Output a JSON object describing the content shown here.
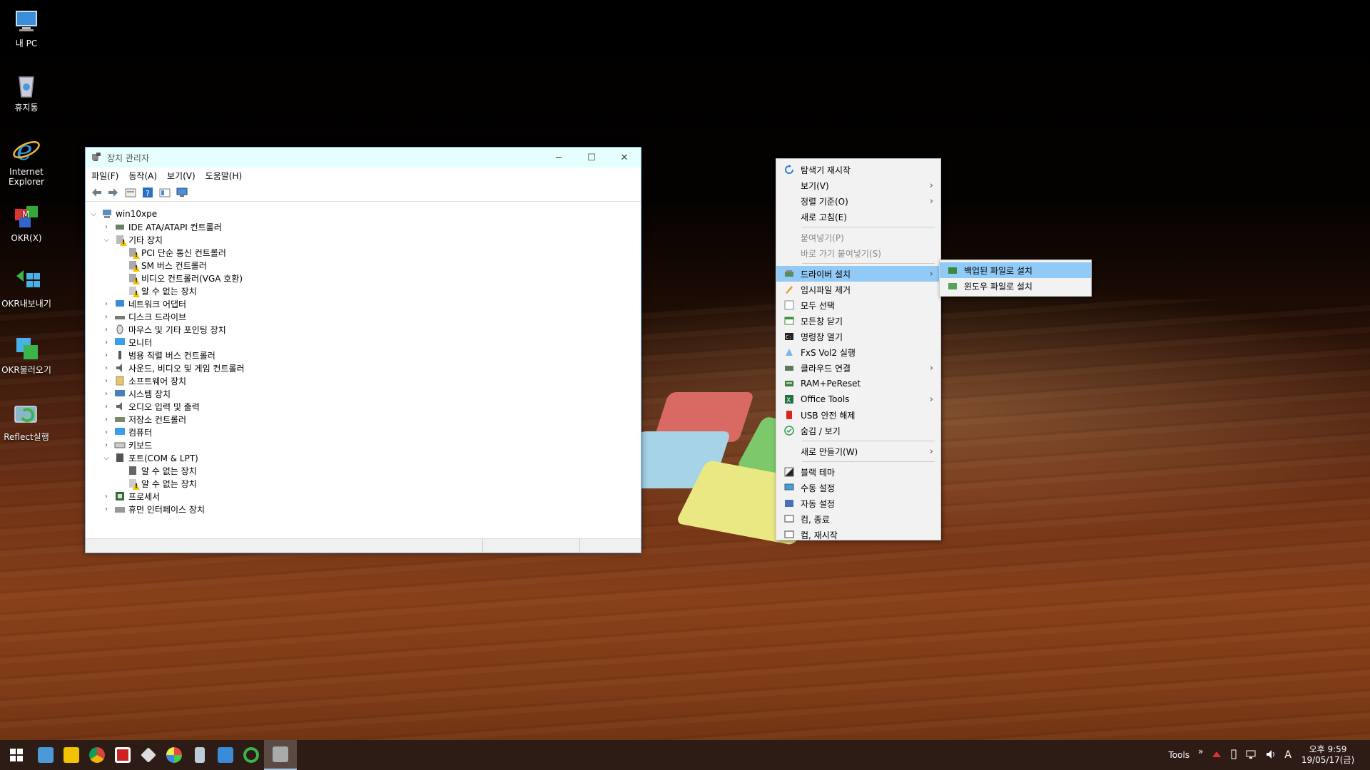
{
  "desktop": {
    "icons": [
      {
        "label": "내 PC"
      },
      {
        "label": "휴지통"
      },
      {
        "label": "Internet Explorer"
      },
      {
        "label": "OKR(X)"
      },
      {
        "label": "OKR내보내기"
      },
      {
        "label": "OKR불러오기"
      },
      {
        "label": "Reflect실행"
      }
    ]
  },
  "window": {
    "title": "장치 관리자",
    "controls": {
      "minimize": "─",
      "maximize": "☐",
      "close": "✕"
    },
    "menu": [
      "파일(F)",
      "동작(A)",
      "보기(V)",
      "도움말(H)"
    ],
    "tree": [
      {
        "label": "win10xpe",
        "expand": "open"
      },
      {
        "label": "IDE ATA/ATAPI 컨트롤러",
        "expand": "closed"
      },
      {
        "label": "기타 장치",
        "expand": "open"
      },
      {
        "label": "PCI 단순 통신 컨트롤러",
        "expand": "none"
      },
      {
        "label": "SM 버스 컨트롤러",
        "expand": "none"
      },
      {
        "label": "비디오 컨트롤러(VGA 호환)",
        "expand": "none"
      },
      {
        "label": "알 수 없는 장치",
        "expand": "none"
      },
      {
        "label": "네트워크 어댑터",
        "expand": "closed"
      },
      {
        "label": "디스크 드라이브",
        "expand": "closed"
      },
      {
        "label": "마우스 및 기타 포인팅 장치",
        "expand": "closed"
      },
      {
        "label": "모니터",
        "expand": "closed"
      },
      {
        "label": "범용 직렬 버스 컨트롤러",
        "expand": "closed"
      },
      {
        "label": "사운드, 비디오 및 게임 컨트롤러",
        "expand": "closed"
      },
      {
        "label": "소프트웨어 장치",
        "expand": "closed"
      },
      {
        "label": "시스템 장치",
        "expand": "closed"
      },
      {
        "label": "오디오 입력 및 출력",
        "expand": "closed"
      },
      {
        "label": "저장소 컨트롤러",
        "expand": "closed"
      },
      {
        "label": "컴퓨터",
        "expand": "closed"
      },
      {
        "label": "키보드",
        "expand": "closed"
      },
      {
        "label": "포트(COM & LPT)",
        "expand": "open"
      },
      {
        "label": "알 수 없는 장치",
        "expand": "none"
      },
      {
        "label": "알 수 없는 장치",
        "expand": "none"
      },
      {
        "label": "프로세서",
        "expand": "closed"
      },
      {
        "label": "휴먼 인터페이스 장치",
        "expand": "closed"
      }
    ]
  },
  "context_menu": {
    "items": [
      {
        "label": "탐색기 재시작",
        "icon": "refresh-icon",
        "arrow": false,
        "disabled": false
      },
      {
        "label": "보기(V)",
        "icon": "",
        "arrow": true,
        "disabled": false
      },
      {
        "label": "정렬 기준(O)",
        "icon": "",
        "arrow": true,
        "disabled": false
      },
      {
        "label": "새로 고침(E)",
        "icon": "",
        "arrow": false,
        "disabled": false
      },
      {
        "label": "붙여넣기(P)",
        "icon": "",
        "arrow": false,
        "disabled": true
      },
      {
        "label": "바로 가기 붙여넣기(S)",
        "icon": "",
        "arrow": false,
        "disabled": true
      },
      {
        "label": "드라이버 설치",
        "icon": "driver-icon",
        "arrow": true,
        "disabled": false,
        "highlighted": true
      },
      {
        "label": "임시파일 제거",
        "icon": "broom-icon",
        "arrow": false,
        "disabled": false
      },
      {
        "label": "모두     선택",
        "icon": "select-all-icon",
        "arrow": false,
        "disabled": false
      },
      {
        "label": "모든창   닫기",
        "icon": "close-windows-icon",
        "arrow": false,
        "disabled": false
      },
      {
        "label": "명령창   열기",
        "icon": "console-icon",
        "arrow": false,
        "disabled": false
      },
      {
        "label": "FxS Vol2 실행",
        "icon": "fxs-icon",
        "arrow": false,
        "disabled": false
      },
      {
        "label": "클라우드 연결",
        "icon": "cloud-icon",
        "arrow": true,
        "disabled": false
      },
      {
        "label": "RAM+PeReset",
        "icon": "ram-icon",
        "arrow": false,
        "disabled": false
      },
      {
        "label": "Office    Tools",
        "icon": "excel-icon",
        "arrow": true,
        "disabled": false
      },
      {
        "label": "USB 안전 해제",
        "icon": "usb-icon",
        "arrow": false,
        "disabled": false
      },
      {
        "label": "숨김   /   보기",
        "icon": "check-icon",
        "arrow": false,
        "disabled": false
      },
      {
        "label": "새로 만들기(W)",
        "icon": "",
        "arrow": true,
        "disabled": false
      },
      {
        "label": "블랙     테마",
        "icon": "theme-icon",
        "arrow": false,
        "disabled": false
      },
      {
        "label": "수동     설정",
        "icon": "monitor-icon",
        "arrow": false,
        "disabled": false
      },
      {
        "label": "자동     설정",
        "icon": "auto-icon",
        "arrow": false,
        "disabled": false
      },
      {
        "label": "컴,     종료",
        "icon": "shutdown-icon",
        "arrow": false,
        "disabled": false
      },
      {
        "label": "컴,    재시작",
        "icon": "restart-icon",
        "arrow": false,
        "disabled": false
      }
    ],
    "submenu": [
      {
        "label": "백업된 파일로 설치",
        "icon": "backup-icon"
      },
      {
        "label": "윈도우 파일로 설치",
        "icon": "windows-file-icon"
      }
    ]
  },
  "taskbar": {
    "tray_label": "Tools",
    "chevron": "»",
    "ime": "A",
    "clock_time": "오후 9:59",
    "clock_date": "19/05/17(금)"
  }
}
